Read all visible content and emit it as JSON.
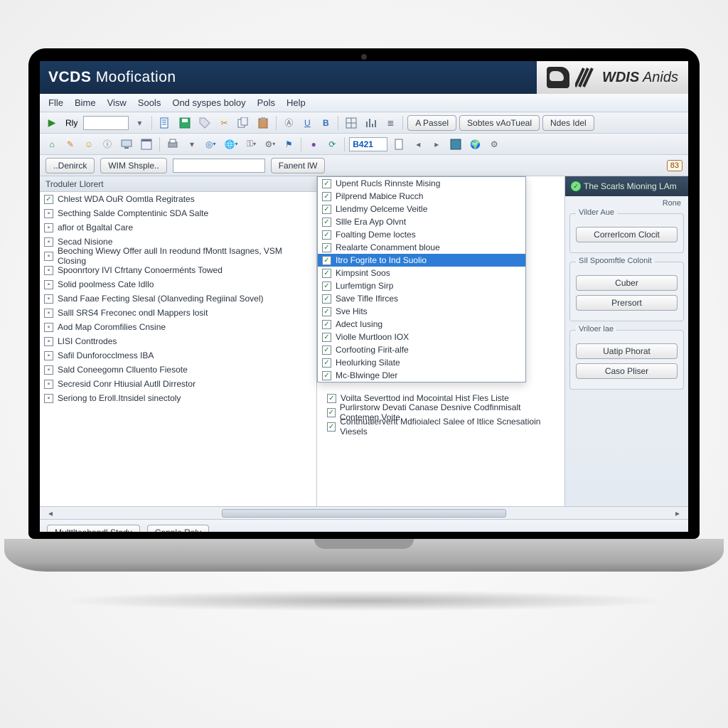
{
  "title_strong": "VCDS",
  "title_rest": " Moofication",
  "brand_strong": "WDIS",
  "brand_rest": " Anids",
  "menu": [
    "Flle",
    "Bime",
    "Visw",
    "Sools",
    "Ond syspes boloy",
    "Pols",
    "Help"
  ],
  "toolbar1": {
    "rly": "Rly",
    "a_passel": "A  Passel",
    "subtes": "Sobtes vAoTueal",
    "ndes": "Ndes Idel"
  },
  "toolbar2": {
    "searchval": "B421"
  },
  "filterbar": {
    "denirck": "..Denirck",
    "wim": "WIM Shsple..",
    "fanent": "Fanent lW",
    "badge": "83"
  },
  "left_header": "Troduler Llorert",
  "left_items": [
    {
      "on": true,
      "label": "Chlest WDA OuR Oomtla Regitrates"
    },
    {
      "on": false,
      "label": "Secthing Salde Comptentinic SDA Salte"
    },
    {
      "on": false,
      "label": "aflor ot Bgaltal Care"
    },
    {
      "on": false,
      "label": "Secad Nisione"
    },
    {
      "on": false,
      "label": "Beoching Wiewy Offer aull In reodund fMontt Isagnes, VSM Closing"
    },
    {
      "on": false,
      "label": "Spoonrtory IVI Cfrtany Conoerménts Towed"
    },
    {
      "on": false,
      "label": "Solid poolmess Cate Idllo"
    },
    {
      "on": false,
      "label": "Sand Faae Fecting Slesal (Olanveding Regiinal Sovel)"
    },
    {
      "on": false,
      "label": "Salll SRS4 Freconec ondl Mappers losit"
    },
    {
      "on": false,
      "label": "Aod Map Coromfilies Cnsine"
    },
    {
      "on": false,
      "label": "LISI Conttrodes"
    },
    {
      "on": false,
      "label": "Safil Dunforocclmess IBA"
    },
    {
      "on": false,
      "label": "Sald Coneegomn Clluento Fiesote"
    },
    {
      "on": false,
      "label": "Secresid Conr Htiusial Autll Dirrestor"
    },
    {
      "on": false,
      "label": "Seriong to Eroll.Itnsidel sinectoly"
    }
  ],
  "dropdown_items": [
    "Upent Rucls Rinnste Mising",
    "Pilprend Mabice Rucch",
    "Llendmy Oelceme Veitle",
    "Sllle Era Ayp Olvnt",
    "Foalting Deme loctes",
    "Realarte Conamment bloue",
    "Itro Fogrite to Ind Suolio",
    "Kimpsint Soos",
    "Lurfemtign Sirp",
    "Save Tifle Ifirces",
    "Sve Hits",
    "Adect Iusing",
    "Violle Murtloon IOX",
    "Corfootíng Firit-alfe",
    "Heolurking Silate",
    "Mc-Blwinge Dler"
  ],
  "dropdown_selected_index": 6,
  "below_items": [
    "Voilta Severttod ind Mocointal Hist Fles Liste",
    "Purlirstorw Devati Canase Desnive Codfinmisalt Contemen Voite",
    "Contnualervent Mdfioialecl Salee of Itlice Scnesatioin Viesels"
  ],
  "right": {
    "head": "The Scarls Mioning LAm",
    "rone": "Rone",
    "group1": "Vilder Aue",
    "btn_correrl": "Correrlcom Clocit",
    "group2": "SIl Spoomftle Colonit",
    "btn_cuber": "Cuber",
    "btn_prersort": "Prersort",
    "group3": "Vriloer lae",
    "btn_uatip": "Uatip Phorat",
    "btn_caso": "Caso Pliser"
  },
  "bottom": {
    "multi": "Multtlteobondl Stady",
    "conple": "Conple Roly"
  }
}
